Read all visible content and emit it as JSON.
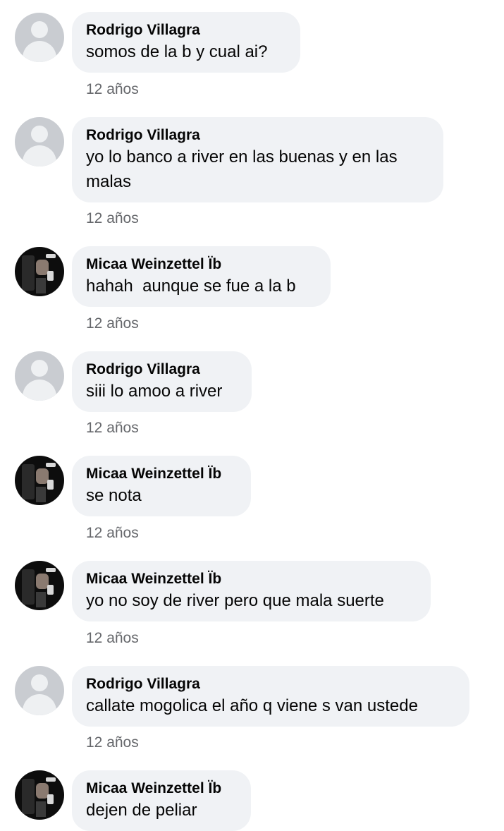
{
  "comments": [
    {
      "author": "Rodrigo Villagra",
      "text": "somos de la b y cual ai?",
      "time": "12 años",
      "avatar": "default-avatar"
    },
    {
      "author": "Rodrigo Villagra",
      "text": "yo lo banco a river en las buenas y en las malas",
      "time": "12 años",
      "avatar": "default-avatar"
    },
    {
      "author": "Micaa Weinzettel Ïb",
      "text": "hahah  aunque se fue a la b",
      "time": "12 años",
      "avatar": "profile-photo"
    },
    {
      "author": "Rodrigo Villagra",
      "text": "siii lo amoo a river",
      "time": "12 años",
      "avatar": "default-avatar"
    },
    {
      "author": "Micaa Weinzettel Ïb",
      "text": "se nota",
      "time": "12 años",
      "avatar": "profile-photo"
    },
    {
      "author": "Micaa Weinzettel Ïb",
      "text": "yo no soy de river pero que mala suerte",
      "time": "12 años",
      "avatar": "profile-photo"
    },
    {
      "author": "Rodrigo Villagra",
      "text": "callate mogolica el año q viene s van ustede",
      "time": "12 años",
      "avatar": "default-avatar"
    },
    {
      "author": "Micaa Weinzettel Ïb",
      "text": "dejen de peliar",
      "time": "",
      "avatar": "profile-photo"
    }
  ]
}
